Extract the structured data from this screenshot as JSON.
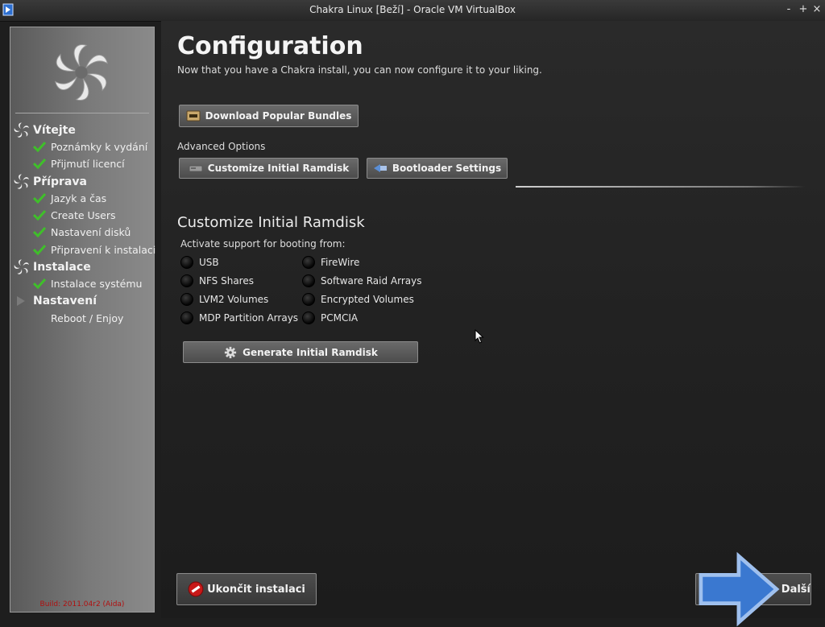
{
  "window": {
    "title": "Chakra Linux [Beží] - Oracle VM VirtualBox",
    "minimize": "-",
    "maximize": "+",
    "close": "×"
  },
  "sidebar": {
    "groups": [
      {
        "label": "Vítejte",
        "items": [
          "Poznámky k vydání",
          "Přijmutí licencí"
        ]
      },
      {
        "label": "Příprava",
        "items": [
          "Jazyk a čas",
          "Create Users",
          "Nastavení disků",
          "Připravení k instalaci"
        ]
      },
      {
        "label": "Instalace",
        "items": [
          "Instalace systému"
        ]
      },
      {
        "label": "Nastavení",
        "items": [
          "Reboot / Enjoy"
        ]
      }
    ],
    "build": "Build: 2011.04r2 (Aida)"
  },
  "main": {
    "title": "Configuration",
    "subtitle": "Now that you have a Chakra install, you can now configure it to your liking.",
    "download_bundles": "Download Popular Bundles",
    "advanced_label": "Advanced Options",
    "customize_ramdisk": "Customize Initial Ramdisk",
    "bootloader_settings": "Bootloader Settings",
    "section_title": "Customize Initial Ramdisk",
    "activate_label": "Activate support for booting from:",
    "options_left": [
      "USB",
      "NFS Shares",
      "LVM2 Volumes",
      "MDP Partition Arrays"
    ],
    "options_right": [
      "FireWire",
      "Software Raid Arrays",
      "Encrypted Volumes",
      "PCMCIA"
    ],
    "generate_ramdisk": "Generate Initial Ramdisk"
  },
  "footer": {
    "quit": "Ukončit instalaci",
    "next": "Další"
  },
  "colors": {
    "check_green": "#3fbf2a",
    "quit_red": "#c81818",
    "next_blue": "#3a78d0",
    "build_text": "#b01010"
  }
}
